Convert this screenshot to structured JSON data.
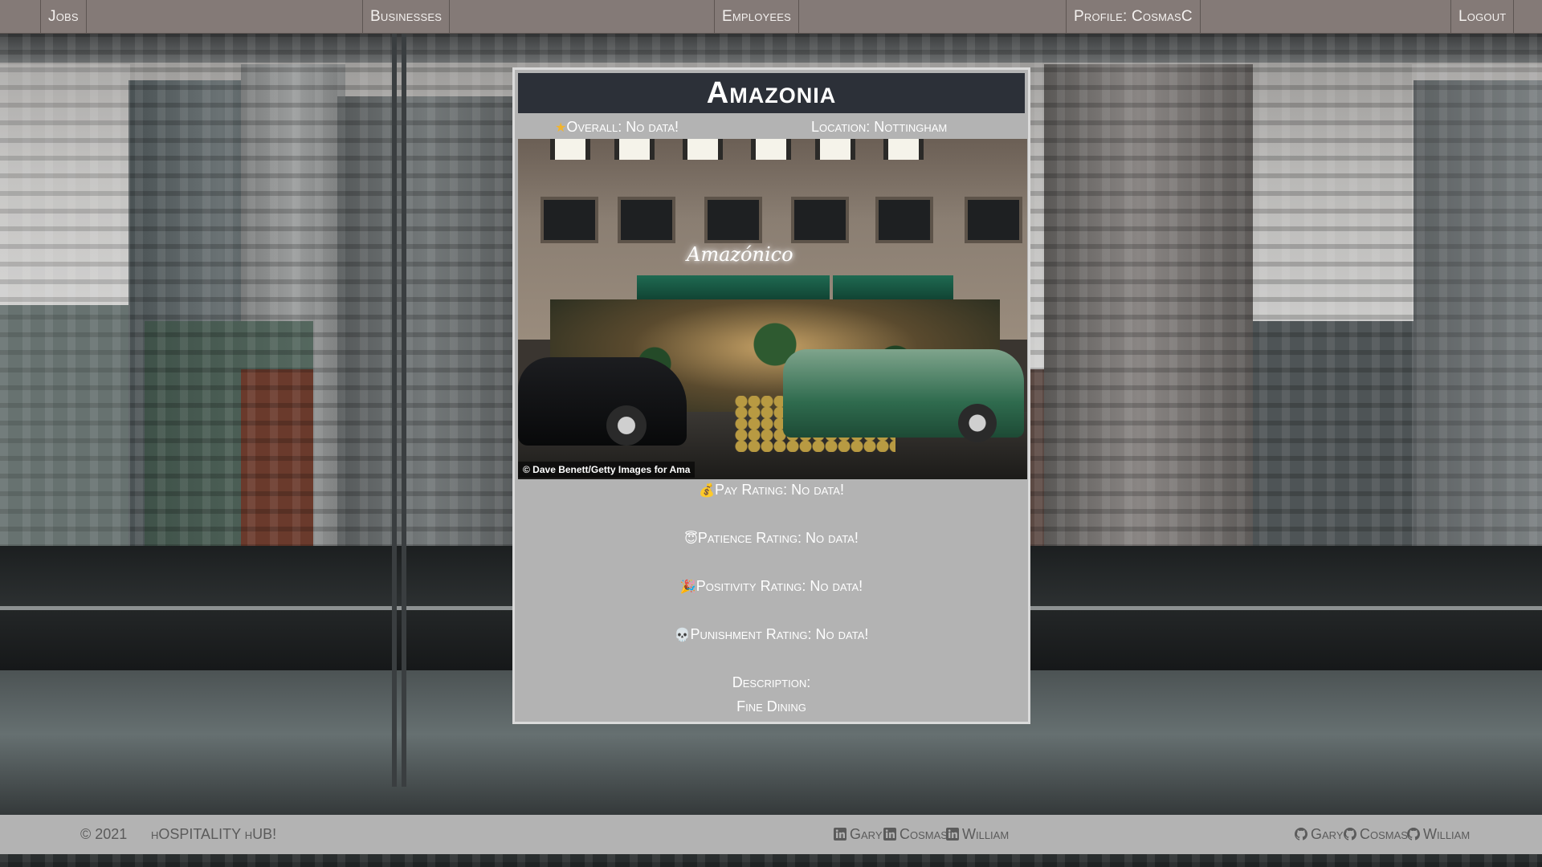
{
  "nav": {
    "jobs": "Jobs",
    "businesses": "Businesses",
    "employees": "Employees",
    "profile": "Profile: CosmasC",
    "logout": "Logout"
  },
  "business": {
    "name": "Amazonia",
    "overall_label": "Overall: No data!",
    "location_label": "Location: Nottingham",
    "photo": {
      "sign_text": "Amazónico",
      "credit": "© Dave Benett/Getty Images for Ama"
    },
    "ratings": {
      "pay": "Pay Rating: No data!",
      "patience": "Patience Rating: No data!",
      "positivity": "Positivity Rating: No data!",
      "punishment": "Punishment Rating: No data!"
    },
    "description_label": "Description:",
    "description": "Fine Dining"
  },
  "icons": {
    "overall": "star-icon",
    "pay": "money-bag-icon",
    "patience": "halo-smile-icon",
    "positivity": "party-popper-icon",
    "punishment": "skull-icon"
  },
  "footer": {
    "copyright": "© 2021",
    "brand": "hOSPITALITY hUB!",
    "linkedin": [
      "Gary",
      "Cosmas",
      "William"
    ],
    "github": [
      "Gary",
      "Cosmas",
      "William"
    ]
  },
  "colors": {
    "navbar": "#847a77",
    "card": "#b3b3b3",
    "title_bar": "#2c3038",
    "footer": "#b3b3b3"
  }
}
